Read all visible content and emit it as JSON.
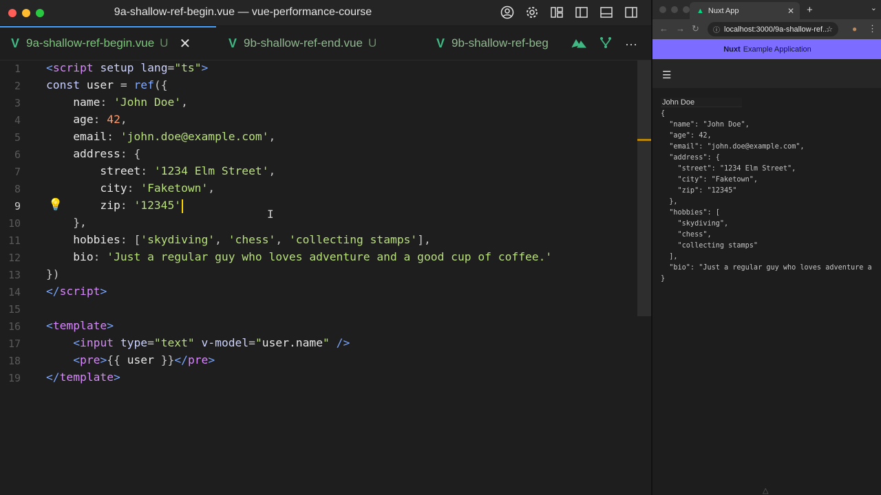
{
  "editor": {
    "window_title": "9a-shallow-ref-begin.vue — vue-performance-course",
    "tabs": [
      {
        "label": "9a-shallow-ref-begin.vue",
        "status": "U",
        "close": "✕"
      },
      {
        "label": "9b-shallow-ref-end.vue",
        "status": "U"
      },
      {
        "label": "9b-shallow-ref-beg"
      }
    ],
    "more_actions": "···",
    "line_numbers": [
      "1",
      "2",
      "3",
      "4",
      "5",
      "6",
      "7",
      "8",
      "9",
      "10",
      "11",
      "12",
      "13",
      "14",
      "15",
      "16",
      "17",
      "18",
      "19"
    ]
  },
  "browser": {
    "tab_title": "Nuxt App",
    "url": "localhost:3000/9a-shallow-ref...",
    "banner_brand": "Nuxt",
    "banner_text": "Example Application",
    "input_value": "John Doe",
    "output": "{\n  \"name\": \"John Doe\",\n  \"age\": 42,\n  \"email\": \"john.doe@example.com\",\n  \"address\": {\n    \"street\": \"1234 Elm Street\",\n    \"city\": \"Faketown\",\n    \"zip\": \"12345\"\n  },\n  \"hobbies\": [\n    \"skydiving\",\n    \"chess\",\n    \"collecting stamps\"\n  ],\n  \"bio\": \"Just a regular guy who loves adventure a\n}"
  },
  "colors": {
    "vue_green": "#41b883",
    "nuxt_banner": "#7c6cff",
    "accent_blue": "#45a0ff"
  }
}
